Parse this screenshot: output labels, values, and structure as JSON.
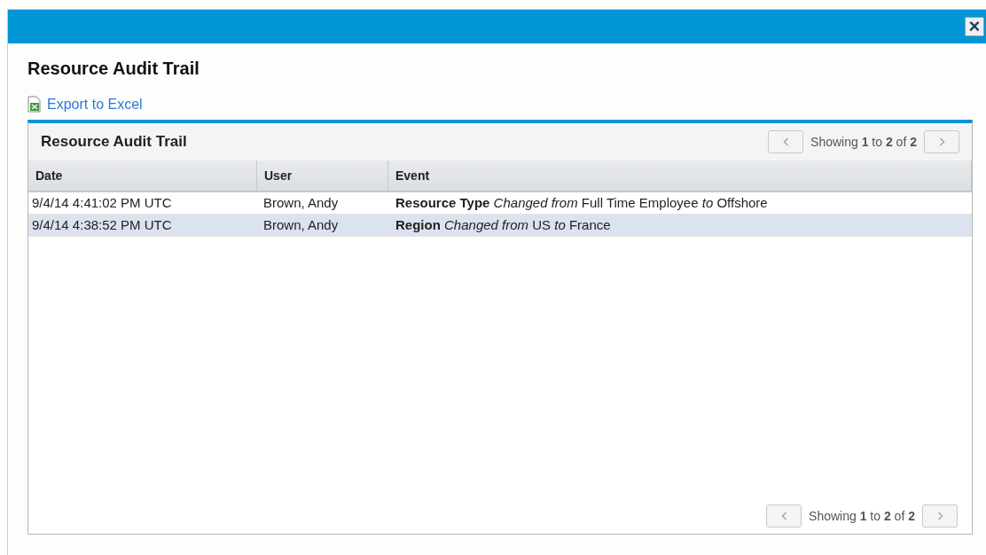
{
  "dialog": {
    "close_label": "×",
    "title": "Resource Audit Trail",
    "export_link": "Export to Excel"
  },
  "panel": {
    "title": "Resource Audit Trail",
    "pager_top": {
      "text": "Showing **1** to **2** of **2**",
      "prev_disabled": true,
      "next_disabled": true
    },
    "columns": [
      "Date",
      "User",
      "Event"
    ],
    "rows": [
      {
        "date": "9/4/14 4:41:02 PM UTC",
        "user": "Brown, Andy",
        "event": "**Resource Type** *Changed from* Full Time Employee *to* Offshore",
        "selected": false
      },
      {
        "date": "9/4/14 4:38:52 PM UTC",
        "user": "Brown, Andy",
        "event": "**Region** *Changed from* US *to* France",
        "selected": true
      }
    ],
    "pager_bottom": {
      "text": "Showing **1** to **2** of **2**",
      "prev_disabled": true,
      "next_disabled": true
    }
  }
}
